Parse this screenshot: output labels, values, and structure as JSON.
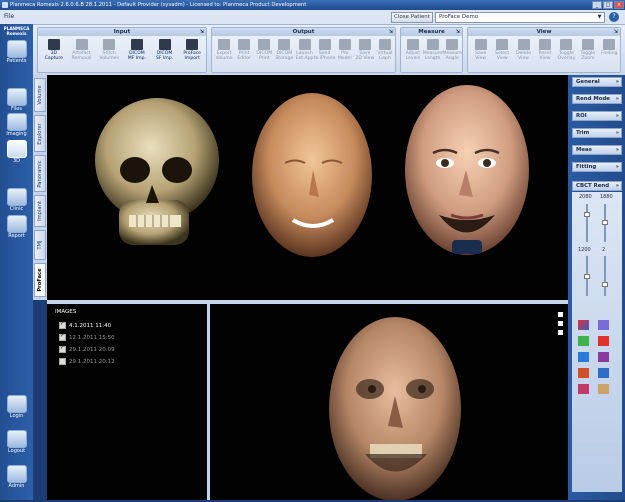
{
  "window": {
    "title": "Planmeca Romexis 2.6.0.6.B  28.1.2011 - Default Provider (sysadm) - Licensed to: Planmeca Product Development",
    "controls": [
      "_",
      "□",
      "×"
    ]
  },
  "menu": {
    "file": "File"
  },
  "patient": {
    "close_label": "Close Patient",
    "selected": "ProFace Demo",
    "help": "?"
  },
  "nav": {
    "brand": "PLANMECA Romexis",
    "items": [
      {
        "label": "Patients",
        "icon": "patients-icon"
      },
      {
        "label": "Files",
        "icon": "files-icon"
      },
      {
        "label": "Imaging",
        "icon": "imaging-icon"
      },
      {
        "label": "3D",
        "icon": "3d-icon"
      },
      {
        "label": "Clinic",
        "icon": "clinic-icon"
      },
      {
        "label": "Report",
        "icon": "report-icon"
      }
    ],
    "bottom_items": [
      {
        "label": "Login",
        "icon": "login-icon"
      },
      {
        "label": "Logout",
        "icon": "logout-icon"
      },
      {
        "label": "Admin",
        "icon": "admin-icon"
      }
    ]
  },
  "toolbar": {
    "groups": [
      {
        "title": "Input",
        "buttons": [
          {
            "label": "3D\nCapture",
            "enabled": true
          },
          {
            "label": "Artefact\nRemoval",
            "enabled": false
          },
          {
            "label": "Stitch\nVolumes",
            "enabled": false
          },
          {
            "label": "DICOM\nMF Imp.",
            "enabled": true
          },
          {
            "label": "DICOM\nSF Imp.",
            "enabled": true
          },
          {
            "label": "ProFace\nImport",
            "enabled": true
          }
        ]
      },
      {
        "title": "Output",
        "buttons": [
          {
            "label": "Export\nVolume",
            "enabled": false
          },
          {
            "label": "Print\nEditor",
            "enabled": false
          },
          {
            "label": "DICOM\nPrint",
            "enabled": false
          },
          {
            "label": "DICOM\nStorage",
            "enabled": false
          },
          {
            "label": "Launch\nExt.App",
            "enabled": false
          },
          {
            "label": "Send\nto iPhone",
            "enabled": false
          },
          {
            "label": "Pro\nModel",
            "enabled": false
          },
          {
            "label": "Save\n2D View",
            "enabled": false
          },
          {
            "label": "Virtual\nCeph",
            "enabled": false
          }
        ]
      },
      {
        "title": "Measure",
        "buttons": [
          {
            "label": "Adjust\nLevels",
            "enabled": false
          },
          {
            "label": "Measure\nLength",
            "enabled": false
          },
          {
            "label": "Measure\nAngle",
            "enabled": false
          }
        ]
      },
      {
        "title": "View",
        "buttons": [
          {
            "label": "Save\nView",
            "enabled": false
          },
          {
            "label": "Select\nView",
            "enabled": false
          },
          {
            "label": "Delete\nView",
            "enabled": false
          },
          {
            "label": "Reset\nView",
            "enabled": false
          },
          {
            "label": "Toggle\nOverlay",
            "enabled": false
          },
          {
            "label": "Toggle\nZoom",
            "enabled": false
          },
          {
            "label": "Finding",
            "enabled": false
          }
        ]
      }
    ]
  },
  "vtabs": [
    "Volume",
    "Explorer",
    "Panoramic",
    "Implant",
    "TMJ",
    "ProFace"
  ],
  "images": {
    "title": "IMAGES",
    "rows": [
      {
        "label": "4.1.2011 11:40",
        "checked": true,
        "color": "#ffffff"
      },
      {
        "label": "12.1.2011 15:50",
        "checked": true,
        "color": "#9a9a9a"
      },
      {
        "label": "29.1.2011 20:09",
        "checked": true,
        "color": "#9a9a9a"
      },
      {
        "label": "29.1.2011 20:12",
        "checked": false,
        "color": "#9a9a9a"
      }
    ]
  },
  "right_panel": {
    "sections": [
      "General",
      "Rend Mode",
      "ROI",
      "Trim",
      "Meas",
      "Fitting",
      "CBCT Rend"
    ],
    "slider_values": {
      "top_left": "2080",
      "top_right": "1880",
      "mid_left": "1200",
      "mid_right": "2"
    }
  }
}
